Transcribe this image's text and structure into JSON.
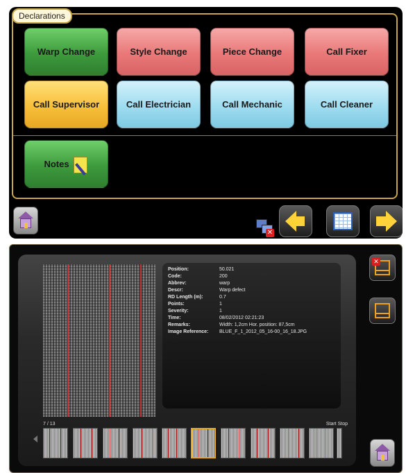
{
  "declarations": {
    "title": "Declarations",
    "buttons": [
      {
        "label": "Warp Change",
        "color": "#4daa4a"
      },
      {
        "label": "Style Change",
        "color": "#e97878"
      },
      {
        "label": "Piece Change",
        "color": "#e97878"
      },
      {
        "label": "Call Fixer",
        "color": "#e97878"
      },
      {
        "label": "Call Supervisor",
        "color": "#f7bf3a"
      },
      {
        "label": "Call Electrician",
        "color": "#9fdcf0"
      },
      {
        "label": "Call Mechanic",
        "color": "#9fdcf0"
      },
      {
        "label": "Call Cleaner",
        "color": "#9fdcf0"
      },
      {
        "label": "Notes",
        "color": "#4daa4a"
      }
    ],
    "toolbar_icons": [
      "home-icon",
      "network-disconnected-icon",
      "arrow-left-icon",
      "calendar-icon",
      "arrow-right-icon"
    ]
  },
  "defect": {
    "fields": [
      {
        "label": "Position:",
        "value": "50.021"
      },
      {
        "label": "Code:",
        "value": "200"
      },
      {
        "label": "Abbrev:",
        "value": "warp"
      },
      {
        "label": "Descr:",
        "value": "Warp defect"
      },
      {
        "label": "RD Length (m):",
        "value": "0.7"
      },
      {
        "label": "Points:",
        "value": "1"
      },
      {
        "label": "Severity:",
        "value": "1"
      },
      {
        "label": "Time:",
        "value": "08/02/2012 02:21:23"
      },
      {
        "label": "Remarks:",
        "value": "Width: 1,2cm Hor. position: 87,5cm"
      },
      {
        "label": "Image Reference:",
        "value": "BLUE_F_1_2012_05_16-00_16_18.JPG"
      }
    ],
    "counter": "7 / 13",
    "start_label": "Start",
    "stop_label": "Stop",
    "thumbnail_count": 10,
    "selected_thumbnail": 6,
    "accent_color": "#e8a820"
  }
}
